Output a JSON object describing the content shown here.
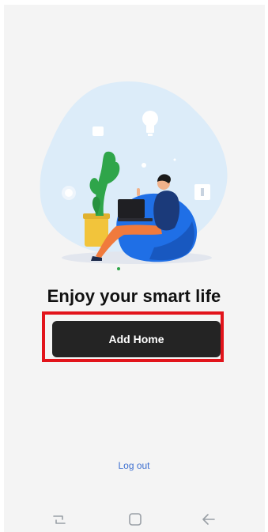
{
  "main": {
    "headline": "Enjoy your smart life",
    "add_home_label": "Add Home",
    "logout_label": "Log out"
  },
  "navbar": {
    "recents_icon": "recent-apps-icon",
    "home_icon": "home-square-icon",
    "back_icon": "back-arrow-icon"
  },
  "colors": {
    "background": "#f4f4f4",
    "button": "#242424",
    "highlight": "#e2141b",
    "link": "#3d6fd0",
    "blob": "#dcecf9",
    "beanbag": "#1f6fe6"
  }
}
